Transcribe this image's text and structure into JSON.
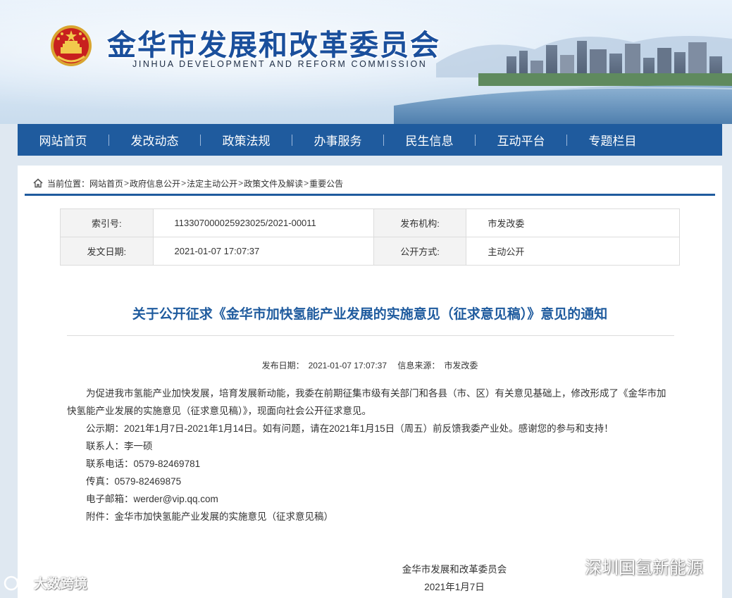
{
  "header": {
    "title": "金华市发展和改革委员会",
    "subtitle": "JINHUA DEVELOPMENT AND REFORM COMMISSION"
  },
  "nav": {
    "items": [
      {
        "label": "网站首页"
      },
      {
        "label": "发改动态"
      },
      {
        "label": "政策法规"
      },
      {
        "label": "办事服务"
      },
      {
        "label": "民生信息"
      },
      {
        "label": "互动平台"
      },
      {
        "label": "专题栏目"
      }
    ]
  },
  "breadcrumb": {
    "prefix": "当前位置：",
    "items": [
      "网站首页",
      "政府信息公开",
      "法定主动公开",
      "政策文件及解读",
      "重要公告"
    ],
    "separator": ">"
  },
  "meta": {
    "index_label": "索引号:",
    "index_value": "113307000025923025/2021-00011",
    "org_label": "发布机构:",
    "org_value": "市发改委",
    "date_label": "发文日期:",
    "date_value": "2021-01-07 17:07:37",
    "mode_label": "公开方式:",
    "mode_value": "主动公开"
  },
  "article": {
    "title": "关于公开征求《金华市加快氢能产业发展的实施意见（征求意见稿）》意见的通知",
    "pub_date_label": "发布日期：",
    "pub_date_value": "2021-01-07 17:07:37",
    "source_label": "信息来源：",
    "source_value": "市发改委",
    "paragraph1": "为促进我市氢能产业加快发展，培育发展新动能，我委在前期征集市级有关部门和各县（市、区）有关意见基础上，修改形成了《金华市加快氢能产业发展的实施意见（征求意见稿）》，现面向社会公开征求意见。",
    "paragraph2": "公示期：2021年1月7日-2021年1月14日。如有问题，请在2021年1月15日（周五）前反馈我委产业处。感谢您的参与和支持！",
    "contact": "联系人：李一硕",
    "phone": "联系电话：0579-82469781",
    "fax": "传真：0579-82469875",
    "email": "电子邮箱：werder@vip.qq.com",
    "attachment_label": "附件：",
    "attachment_link": "金华市加快氢能产业发展的实施意见（征求意见稿）",
    "signature_org": "金华市发展和改革委员会",
    "signature_date": "2021年1月7日"
  },
  "watermarks": {
    "left": "大数跨境",
    "right": "深圳国氢新能源"
  },
  "colors": {
    "brand_blue": "#1f5b9e",
    "title_blue": "#1a4f9c",
    "page_bg": "#dfe8f1"
  }
}
